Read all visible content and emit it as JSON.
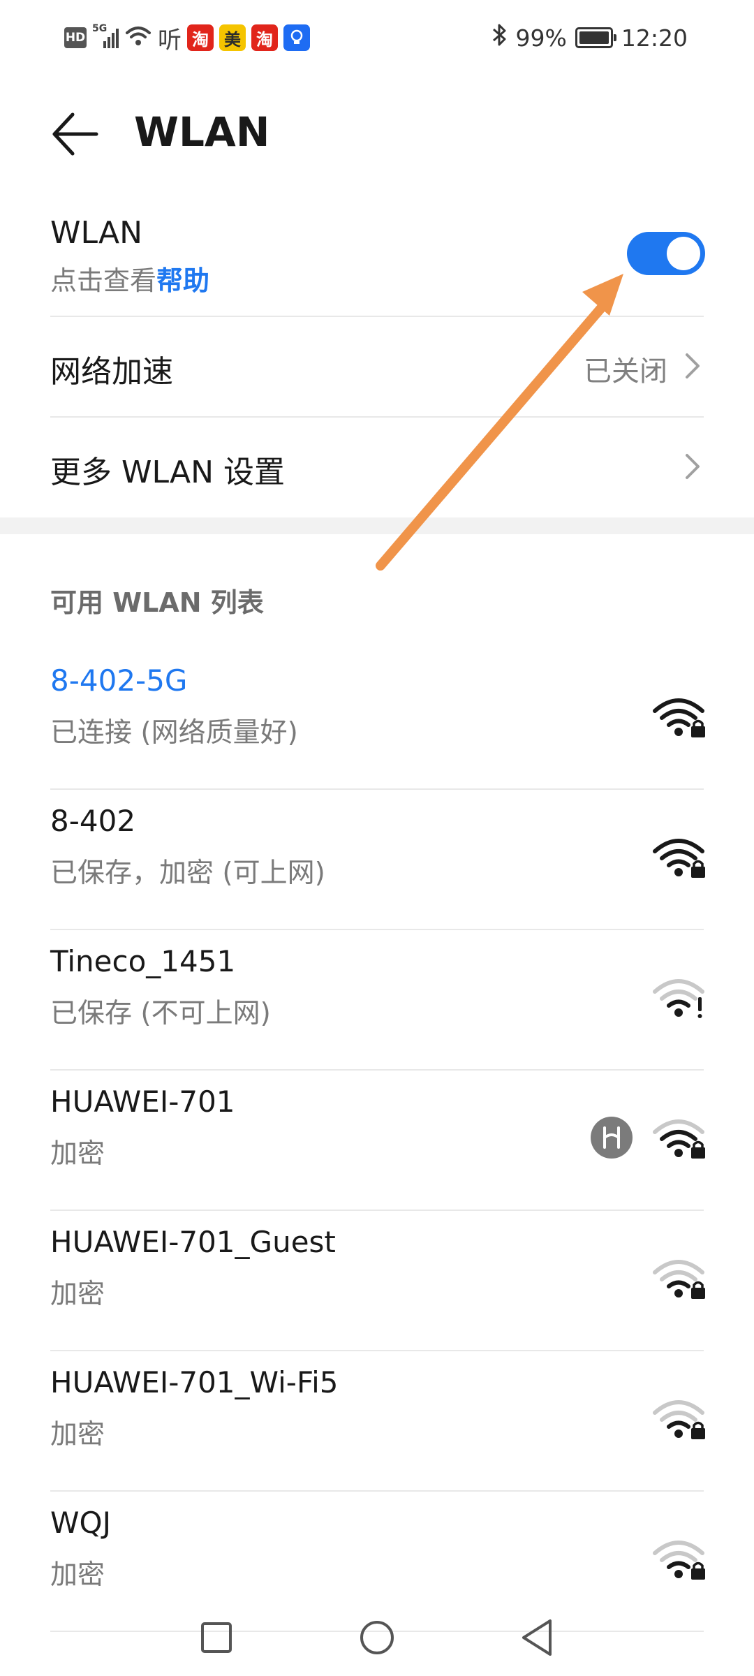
{
  "status_bar": {
    "hd_badge": "HD",
    "signal_label": "5G",
    "audio_app": "听",
    "app_icons": [
      {
        "label": "淘",
        "color": "#e1251b"
      },
      {
        "label": "美",
        "color": "#f5c400",
        "text_color": "#2b2b2b"
      },
      {
        "label": "淘",
        "color": "#e1251b"
      },
      {
        "label": "",
        "color": "#1e6cf3"
      }
    ],
    "battery": "99%",
    "battery_level": 0.99,
    "time": "12:20"
  },
  "header": {
    "title": "WLAN"
  },
  "wlan_toggle": {
    "label": "WLAN",
    "help_prefix": "点击查看",
    "help_link": "帮助",
    "enabled": true
  },
  "network_boost": {
    "label": "网络加速",
    "value": "已关闭"
  },
  "more_settings": {
    "label": "更多 WLAN 设置"
  },
  "available_list": {
    "header": "可用 WLAN 列表",
    "networks": [
      {
        "name": "8-402-5G",
        "status": "已连接 (网络质量好)",
        "connected": true,
        "signal": 4,
        "icon": "wifi-lock-icon"
      },
      {
        "name": "8-402",
        "status": "已保存，加密 (可上网)",
        "connected": false,
        "signal": 4,
        "icon": "wifi-lock-icon"
      },
      {
        "name": "Tineco_1451",
        "status": "已保存 (不可上网)",
        "connected": false,
        "signal": 2,
        "icon": "wifi-warning-icon"
      },
      {
        "name": "HUAWEI-701",
        "status": "加密",
        "connected": false,
        "signal": 3,
        "icon": "wifi-lock-icon",
        "hilink": true
      },
      {
        "name": "HUAWEI-701_Guest",
        "status": "加密",
        "connected": false,
        "signal": 2,
        "icon": "wifi-lock-icon"
      },
      {
        "name": "HUAWEI-701_Wi-Fi5",
        "status": "加密",
        "connected": false,
        "signal": 2,
        "icon": "wifi-lock-icon"
      },
      {
        "name": "WQJ",
        "status": "加密",
        "connected": false,
        "signal": 2,
        "icon": "wifi-lock-icon"
      }
    ]
  },
  "colors": {
    "accent": "#1f78f0",
    "annotation_arrow": "#f0944a"
  }
}
